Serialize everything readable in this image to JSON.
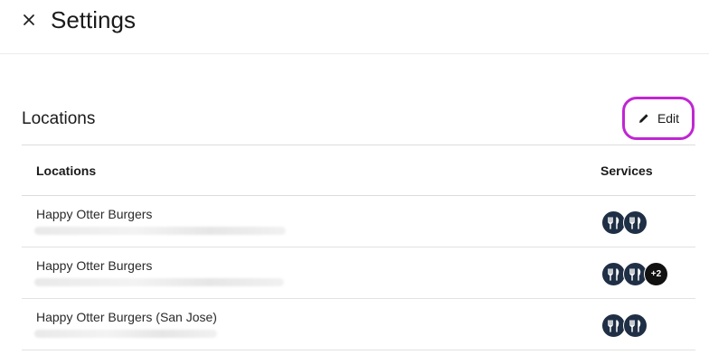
{
  "header": {
    "title": "Settings",
    "close_icon": "close-icon"
  },
  "section": {
    "title": "Locations",
    "edit_label": "Edit",
    "edit_icon": "pencil-icon",
    "edit_highlight_color": "#c026d3"
  },
  "table": {
    "columns": [
      "Locations",
      "Services"
    ],
    "rows": [
      {
        "name": "Happy Otter Burgers",
        "services": [
          "utensils-icon",
          "utensils-icon"
        ],
        "extra": ""
      },
      {
        "name": "Happy Otter Burgers",
        "services": [
          "utensils-icon",
          "utensils-icon"
        ],
        "extra": "+2"
      },
      {
        "name": "Happy Otter Burgers (San Jose)",
        "services": [
          "utensils-icon",
          "utensils-icon"
        ],
        "extra": ""
      }
    ]
  },
  "colors": {
    "service_icon_bg": "#1f2f45",
    "more_badge_bg": "#111111"
  }
}
